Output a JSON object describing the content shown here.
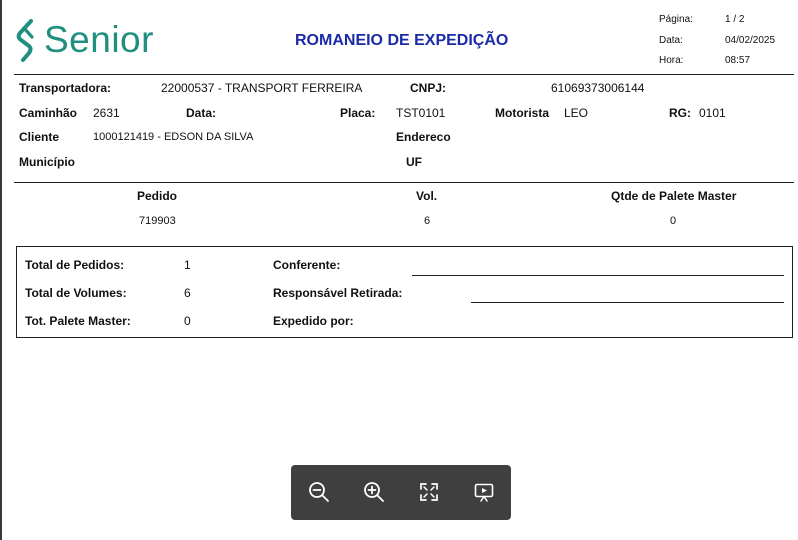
{
  "header": {
    "logo_text": "Senior",
    "title": "ROMANEIO DE EXPEDIÇÃO",
    "page_label": "Página:",
    "page_value": "1 / 2",
    "date_label": "Data:",
    "date_value": "04/02/2025",
    "time_label": "Hora:",
    "time_value": "08:57"
  },
  "info": {
    "transportadora_label": "Transportadora:",
    "transportadora_value": "22000537 - TRANSPORT FERREIRA",
    "cnpj_label": "CNPJ:",
    "cnpj_value": "61069373006144",
    "caminhao_label": "Caminhão",
    "caminhao_value": "2631",
    "data_label": "Data:",
    "placa_label": "Placa:",
    "placa_value": "TST0101",
    "motorista_label": "Motorista",
    "motorista_value": "LEO",
    "rg_label": "RG:",
    "rg_value": "0101",
    "cliente_label": "Cliente",
    "cliente_value": "1000121419 - EDSON DA SILVA",
    "endereco_label": "Endereco",
    "municipio_label": "Município",
    "uf_label": "UF"
  },
  "orders": {
    "headers": [
      "Pedido",
      "Vol.",
      "Qtde de Palete Master"
    ],
    "rows": [
      [
        "719903",
        "6",
        "0"
      ]
    ]
  },
  "summary": {
    "total_pedidos_label": "Total de Pedidos:",
    "total_pedidos_value": "1",
    "total_volumes_label": "Total de Volumes:",
    "total_volumes_value": "6",
    "tot_palete_label": "Tot. Palete Master:",
    "tot_palete_value": "0",
    "conferente_label": "Conferente:",
    "responsavel_label": "Responsável Retirada:",
    "expedido_label": "Expedido por:"
  },
  "toolbar": {
    "icons": [
      "zoom-out-icon",
      "zoom-in-icon",
      "fit-screen-icon",
      "presentation-icon"
    ]
  },
  "colors": {
    "brand_green": "#1f8f80",
    "title_blue": "#1a2aa8",
    "toolbar_bg": "#3f3f3f"
  }
}
